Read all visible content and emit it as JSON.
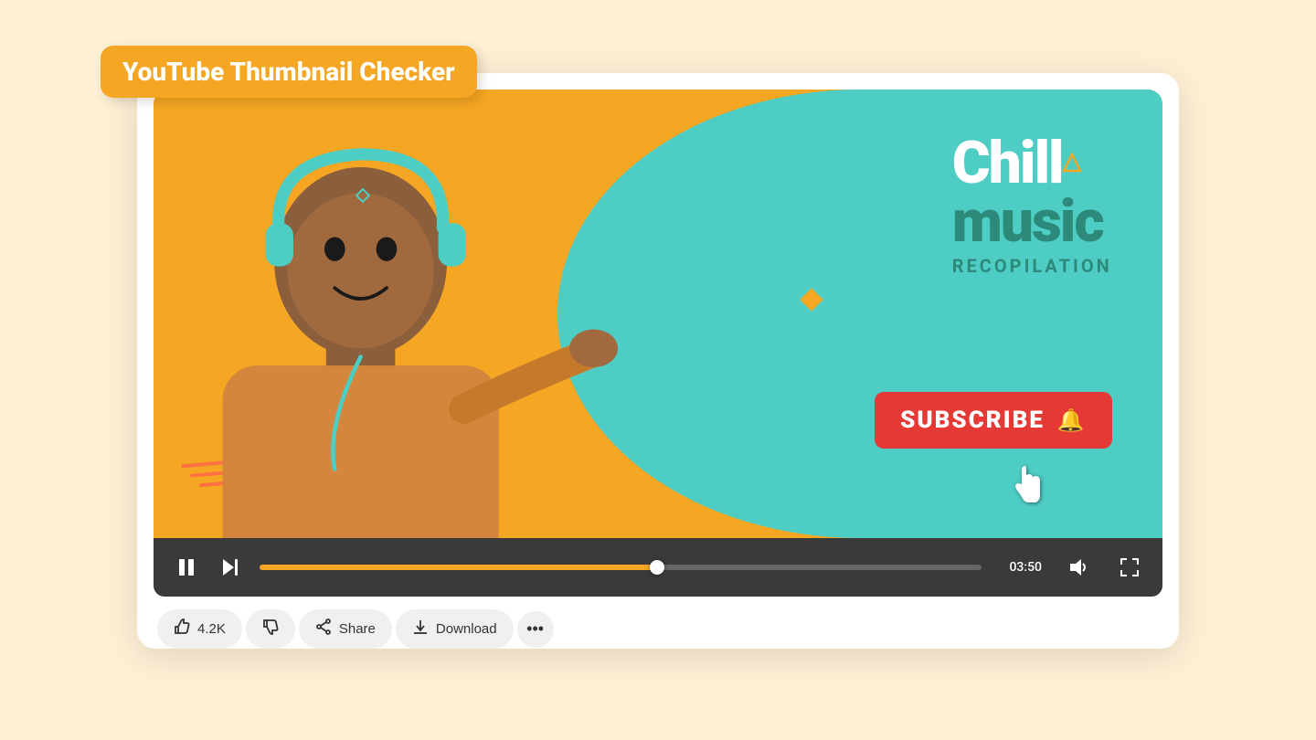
{
  "app": {
    "title": "YouTube Thumbnail Checker",
    "background_color": "#fdf0d5"
  },
  "thumbnail": {
    "title_line1": "Chill",
    "title_line2": "music",
    "title_line3": "RECOPILATION",
    "subscribe_text": "SUBSCRIBE",
    "background_orange": "#f5a623",
    "background_teal": "#4ecdc4"
  },
  "controls": {
    "time": "03:50",
    "progress_percent": 55
  },
  "actions": {
    "like_label": "4.2K",
    "share_label": "Share",
    "download_label": "Download",
    "more_label": "..."
  }
}
